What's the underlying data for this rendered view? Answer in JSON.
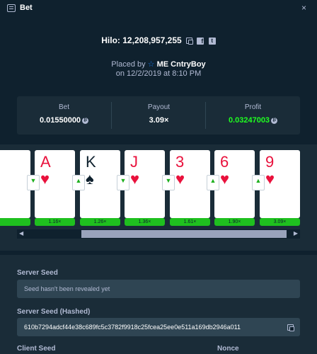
{
  "window": {
    "title": "Bet",
    "close_glyph": "×"
  },
  "game": {
    "id_text": "Hilo: 12,208,957,255"
  },
  "placed": {
    "prefix": "Placed by",
    "rank_badge": "ME",
    "username": "CntryBoy",
    "date_text": "on 12/2/2019 at 8:10 PM"
  },
  "stats": {
    "bet": {
      "label": "Bet",
      "value": "0.01550000"
    },
    "payout": {
      "label": "Payout",
      "value": "3.09×"
    },
    "profit": {
      "label": "Profit",
      "value": "0.03247003"
    }
  },
  "cards": [
    {
      "rank": "A",
      "suit": "♥",
      "color": "#e9113c",
      "choice": "lower",
      "multiplier": "1.16×"
    },
    {
      "rank": "K",
      "suit": "♠",
      "color": "#0f212e",
      "choice": "higher",
      "multiplier": "1.26×"
    },
    {
      "rank": "J",
      "suit": "♥",
      "color": "#e9113c",
      "choice": "lower",
      "multiplier": "1.36×"
    },
    {
      "rank": "3",
      "suit": "♥",
      "color": "#e9113c",
      "choice": "lower",
      "multiplier": "1.61×"
    },
    {
      "rank": "6",
      "suit": "♥",
      "color": "#e9113c",
      "choice": "higher",
      "multiplier": "1.90×"
    },
    {
      "rank": "9",
      "suit": "♥",
      "color": "#e9113c",
      "choice": "higher",
      "multiplier": "3.09×"
    }
  ],
  "seeds": {
    "server_label": "Server Seed",
    "server_placeholder": "Seed hasn't been revealed yet",
    "hashed_label": "Server Seed (Hashed)",
    "hashed_value": "610b7294adcf44e38c689fc5c3782f9918c25fcea25ee0e511a169db2946a011",
    "client_label": "Client Seed",
    "nonce_label": "Nonce"
  },
  "colors": {
    "accent_green": "#1fff20",
    "background": "#0f212e",
    "panel": "#1a2c38",
    "card_red": "#e9113c"
  }
}
